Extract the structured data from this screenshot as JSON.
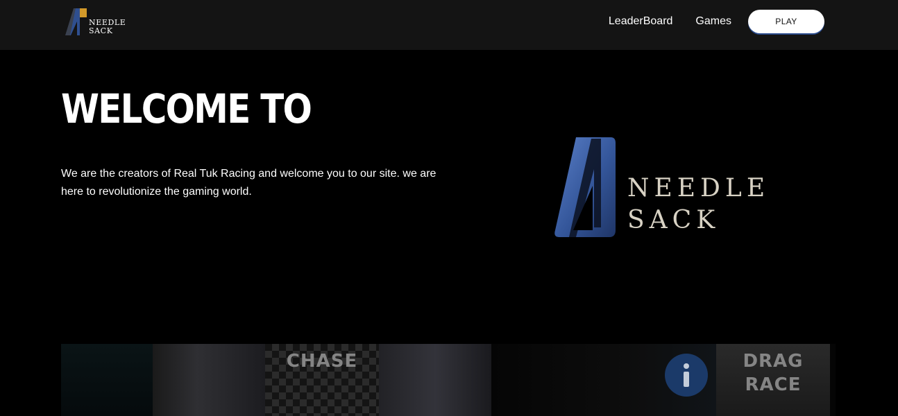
{
  "nav": {
    "logo_line1": "NEEDLE",
    "logo_line2": "SACK",
    "links": [
      "LeaderBoard",
      "Games"
    ],
    "play_label": "PLAY"
  },
  "hero": {
    "title": "WELCOME TO",
    "description": "We are the creators of Real Tuk Racing and welcome you to our site. we are here to revolutionize the gaming world.",
    "logo_line1": "NEEDLE",
    "logo_line2": "SACK"
  },
  "games": {
    "tiles": [
      "CHASE",
      "DRAG\nRACE"
    ]
  },
  "colors": {
    "navbar_bg": "#141414",
    "page_bg": "#000000",
    "logo_blue": "#2f4f8f",
    "logo_gold": "#d39a2a",
    "play_shadow": "#2a4b8c"
  }
}
